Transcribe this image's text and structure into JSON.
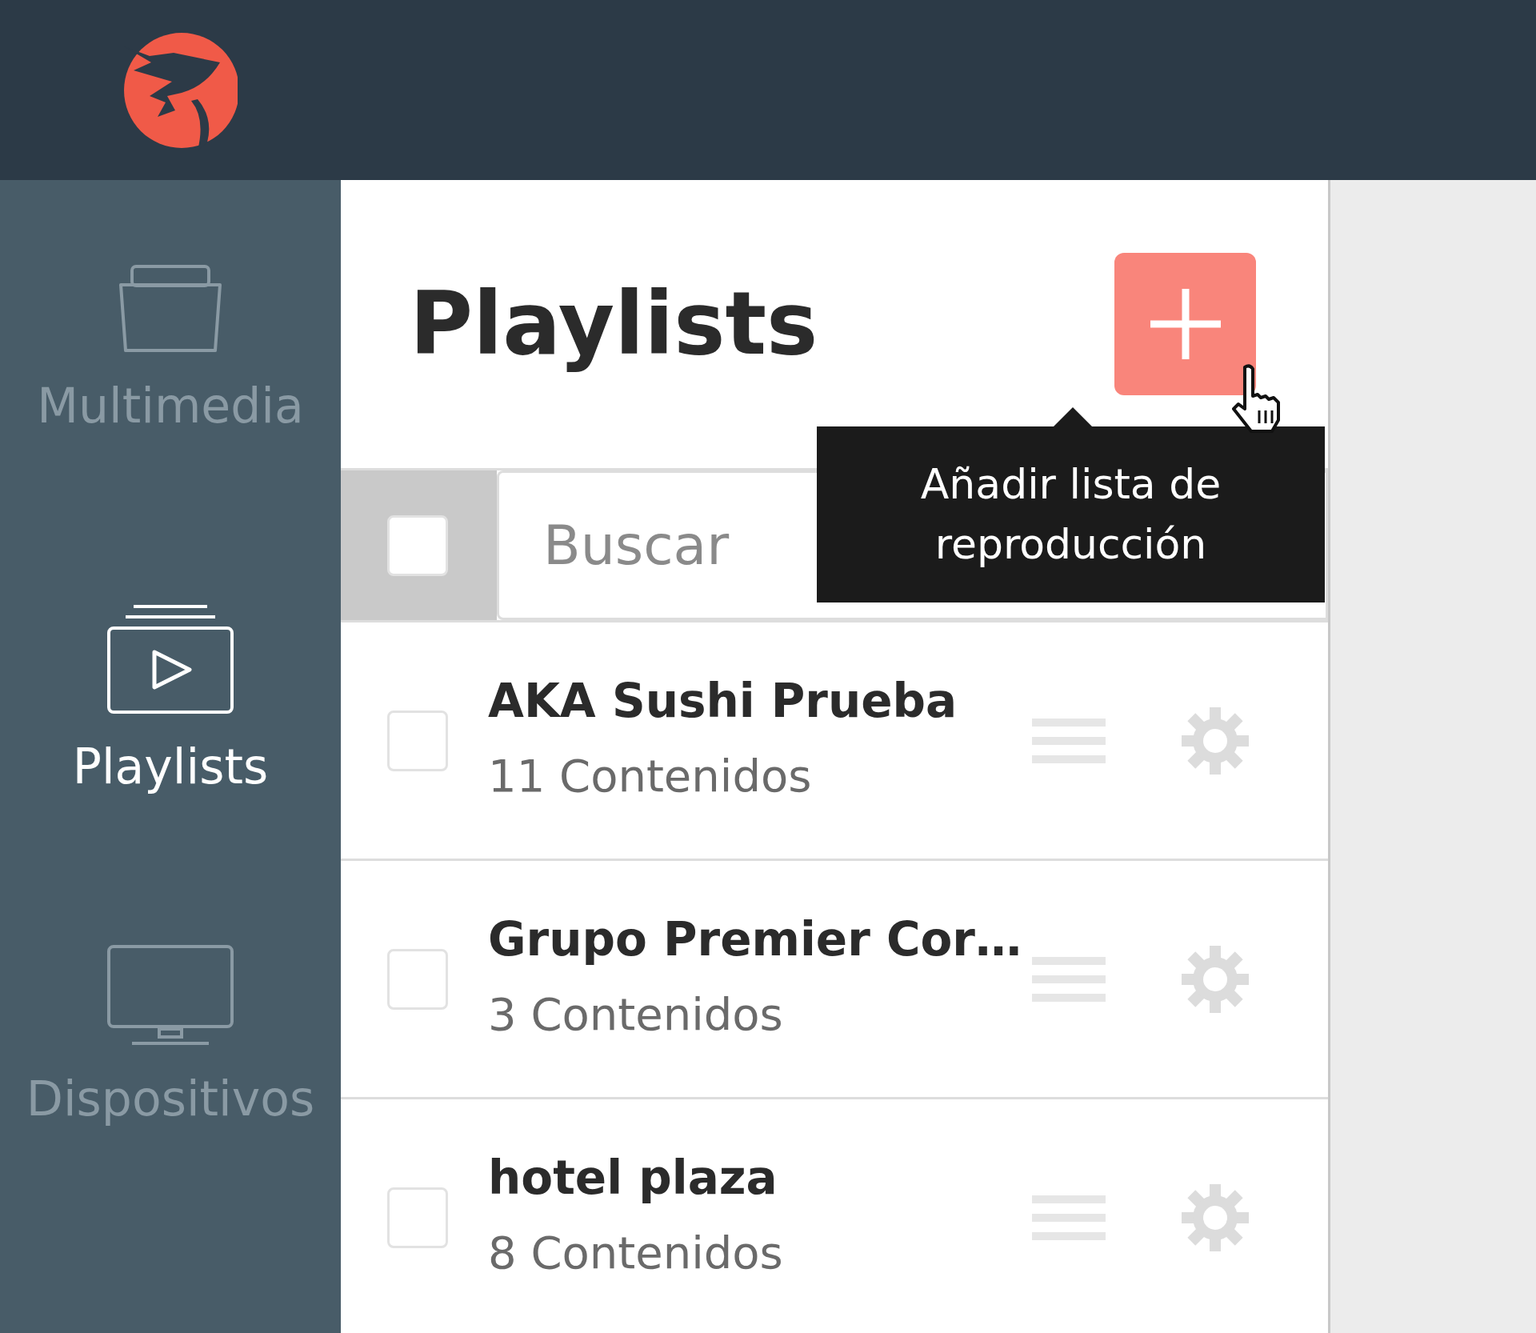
{
  "sidebar": {
    "items": [
      {
        "label": "Multimedia",
        "selected": false
      },
      {
        "label": "Playlists",
        "selected": true
      },
      {
        "label": "Dispositivos",
        "selected": false
      }
    ]
  },
  "header": {
    "title": "Playlists",
    "tooltip": "Añadir lista de reproducción"
  },
  "search": {
    "placeholder": "Buscar",
    "checked": false
  },
  "playlists": [
    {
      "name": "AKA Sushi Prueba",
      "count": "11 Contenidos",
      "checked": false
    },
    {
      "name": "Grupo Premier Cor…",
      "count": "3 Contenidos",
      "checked": false
    },
    {
      "name": "hotel plaza",
      "count": "8 Contenidos",
      "checked": false
    }
  ]
}
